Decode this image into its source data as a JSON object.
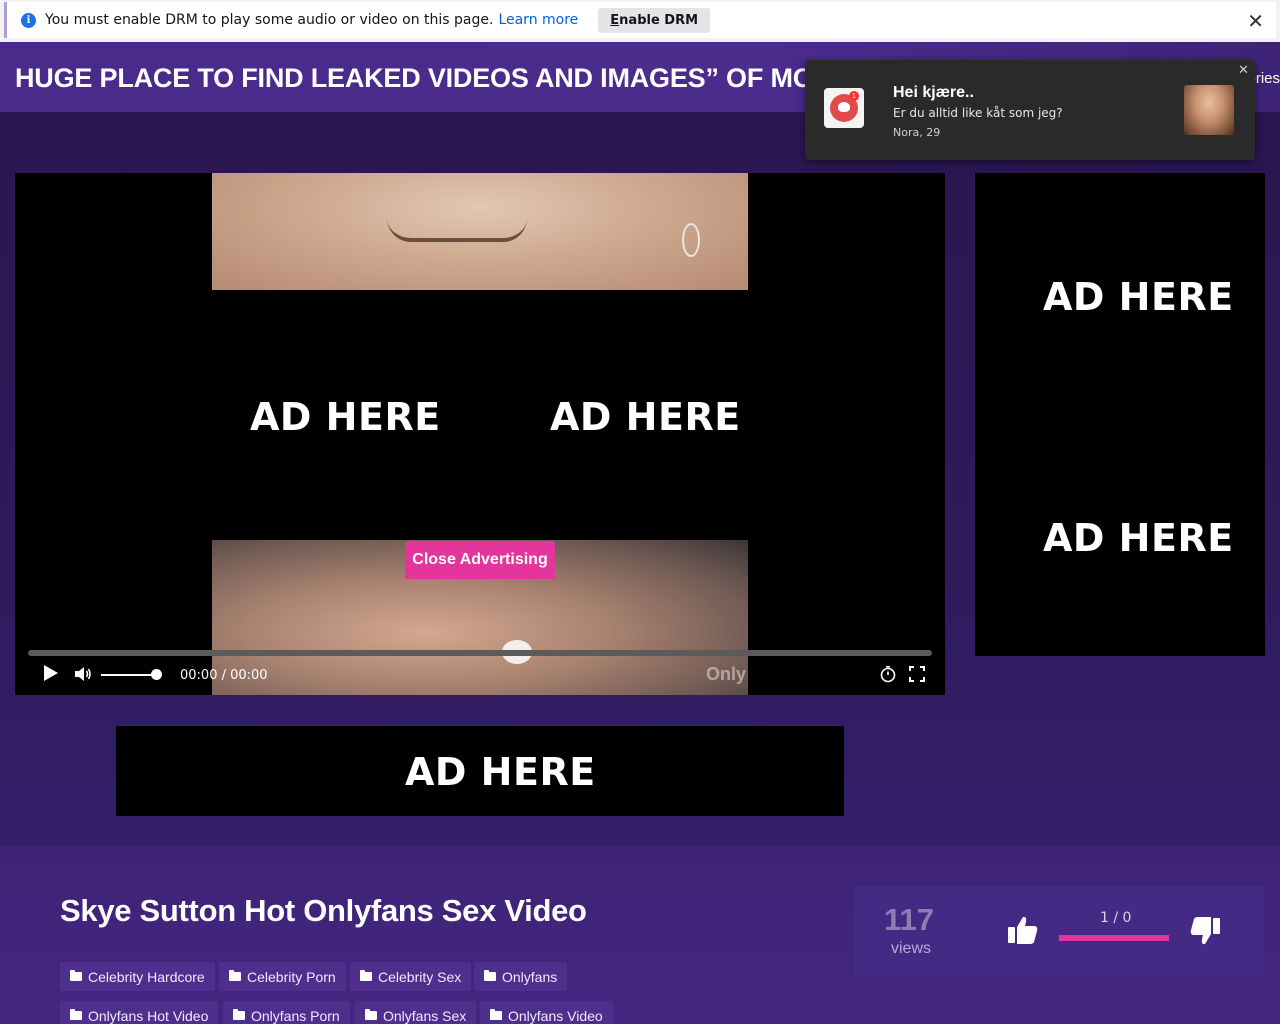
{
  "drm_bar": {
    "message": "You must enable DRM to play some audio or video on this page.",
    "learn_more": "Learn more",
    "enable_button": "Enable DRM",
    "close": "✕"
  },
  "header": {
    "site_title": "HUGE PLACE TO FIND LEAKED VIDEOS AND IMAGES” OF MODELS",
    "nav_clip": "ories"
  },
  "notification": {
    "title": "Hei kjære..",
    "message": "Er du alltid like kåt som jeg?",
    "sender": "Nora, 29",
    "badge": "1",
    "close": "✕"
  },
  "player": {
    "ad_left": "AD HERE",
    "ad_right": "AD HERE",
    "close_ad_label": "Close Advertising",
    "time_display": "00:00 / 00:00",
    "watermark": "Only",
    "volume_level": 1.0
  },
  "side_ad": {
    "ad_1": "AD HERE",
    "ad_2": "AD HERE"
  },
  "bottom_ad": {
    "text": "AD HERE"
  },
  "video_info": {
    "title": "Skye Sutton Hot Onlyfans Sex Video",
    "tags": [
      "Celebrity Hardcore",
      "Celebrity Porn",
      "Celebrity Sex",
      "Onlyfans",
      "Onlyfans Hot Video",
      "Onlyfans Porn",
      "Onlyfans Sex",
      "Onlyfans Video"
    ],
    "views_count": "117",
    "views_label": "views",
    "rating_text": "1 / 0",
    "rating_fraction": 1.0
  },
  "colors": {
    "accent": "#e3359c",
    "header_bg": "#4a2a8a",
    "page_bg": "#2e1c57",
    "tag_bg": "#4e2f8e"
  }
}
